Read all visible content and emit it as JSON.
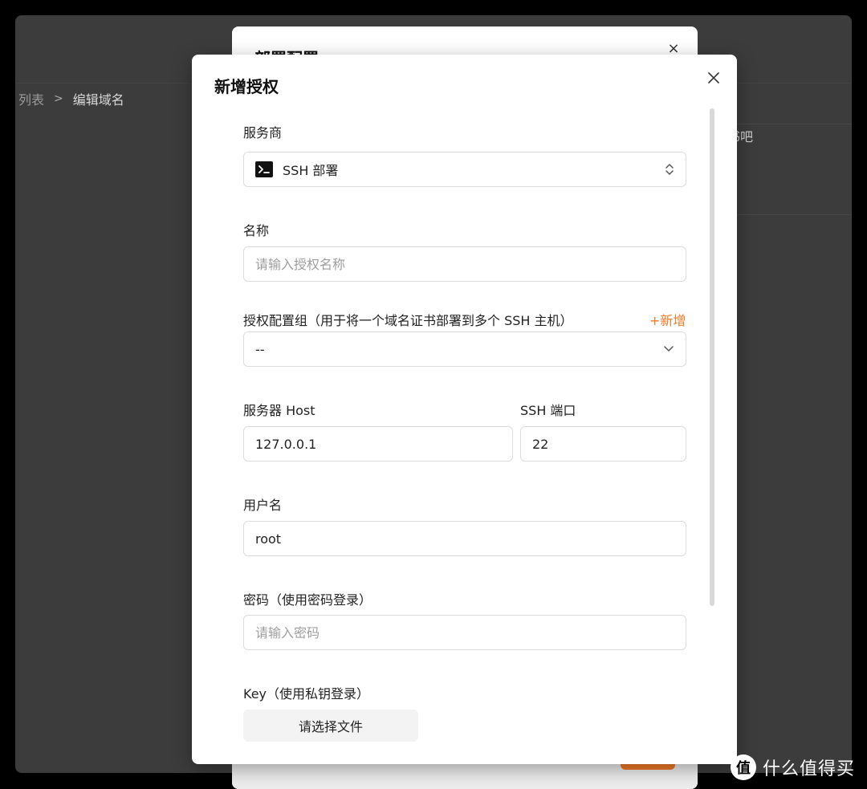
{
  "background": {
    "breadcrumb": {
      "parent": "列表",
      "separator": ">",
      "current": "编辑域名"
    },
    "card_text": "证书吧"
  },
  "back_dialog": {
    "title": "部署配置",
    "close_glyph": "×"
  },
  "dialog": {
    "title": "新增授权",
    "close_glyph": "×"
  },
  "form": {
    "provider": {
      "label": "服务商",
      "value": "SSH 部署"
    },
    "name": {
      "label": "名称",
      "value": "",
      "placeholder": "请输入授权名称"
    },
    "group": {
      "label": "授权配置组（用于将一个域名证书部署到多个 SSH 主机）",
      "add_label": "+新增",
      "value": "--"
    },
    "host": {
      "label": "服务器 Host",
      "value": "127.0.0.1"
    },
    "port": {
      "label": "SSH 端口",
      "value": "22"
    },
    "username": {
      "label": "用户名",
      "value": "root"
    },
    "password": {
      "label": "密码（使用密码登录）",
      "value": "",
      "placeholder": "请输入密码"
    },
    "key": {
      "label": "Key（使用私钥登录）",
      "button_label": "请选择文件"
    }
  },
  "watermark": {
    "badge": "值",
    "text": "什么值得买"
  },
  "colors": {
    "accent": "#f07a28",
    "overlay": "#3c3c3c",
    "border": "#dcdcdc"
  }
}
